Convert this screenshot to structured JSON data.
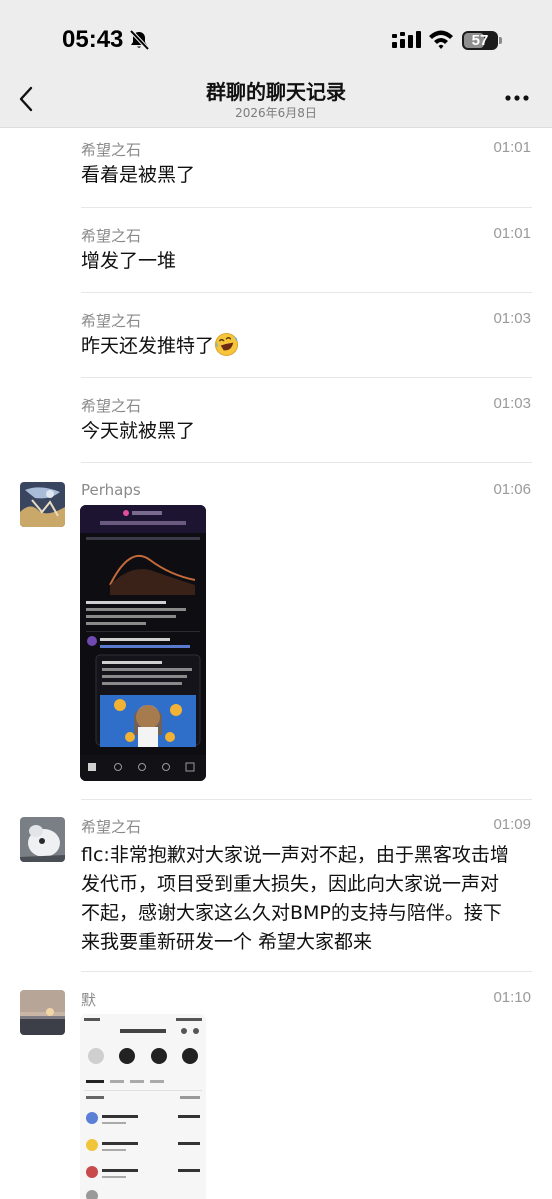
{
  "status_bar": {
    "time": "05:43",
    "battery": "57"
  },
  "header": {
    "title": "群聊的聊天记录",
    "date": "2026年6月8日"
  },
  "messages": [
    {
      "sender": "希望之石",
      "time": "01:01",
      "text": "看着是被黑了"
    },
    {
      "sender": "希望之石",
      "time": "01:01",
      "text": "增发了一堆"
    },
    {
      "sender": "希望之石",
      "time": "01:03",
      "text": "昨天还发推特了"
    },
    {
      "sender": "希望之石",
      "time": "01:03",
      "text": "今天就被黑了"
    },
    {
      "sender": "Perhaps",
      "time": "01:06"
    },
    {
      "sender": "希望之石",
      "time": "01:09",
      "lines": [
        "flc:非常抱歉对大家说一声对不起，由于黑客攻击增",
        "发代币，项目受到重大损失，因此向大家说一声对",
        "不起，感谢大家这么久对BMP的支持与陪伴。接下",
        "来我要重新研发一个 希望大家都来"
      ]
    },
    {
      "sender": "默",
      "time": "01:10"
    }
  ],
  "icons": {
    "emoji": "rolling-on-floor-laughing",
    "back": "chevron-left-icon",
    "more": "more-dots-icon",
    "silent": "bell-slash-icon"
  },
  "colors": {
    "bar_bg": "#ededed",
    "page_bg": "#ffffff",
    "name": "#8a8a8a"
  }
}
